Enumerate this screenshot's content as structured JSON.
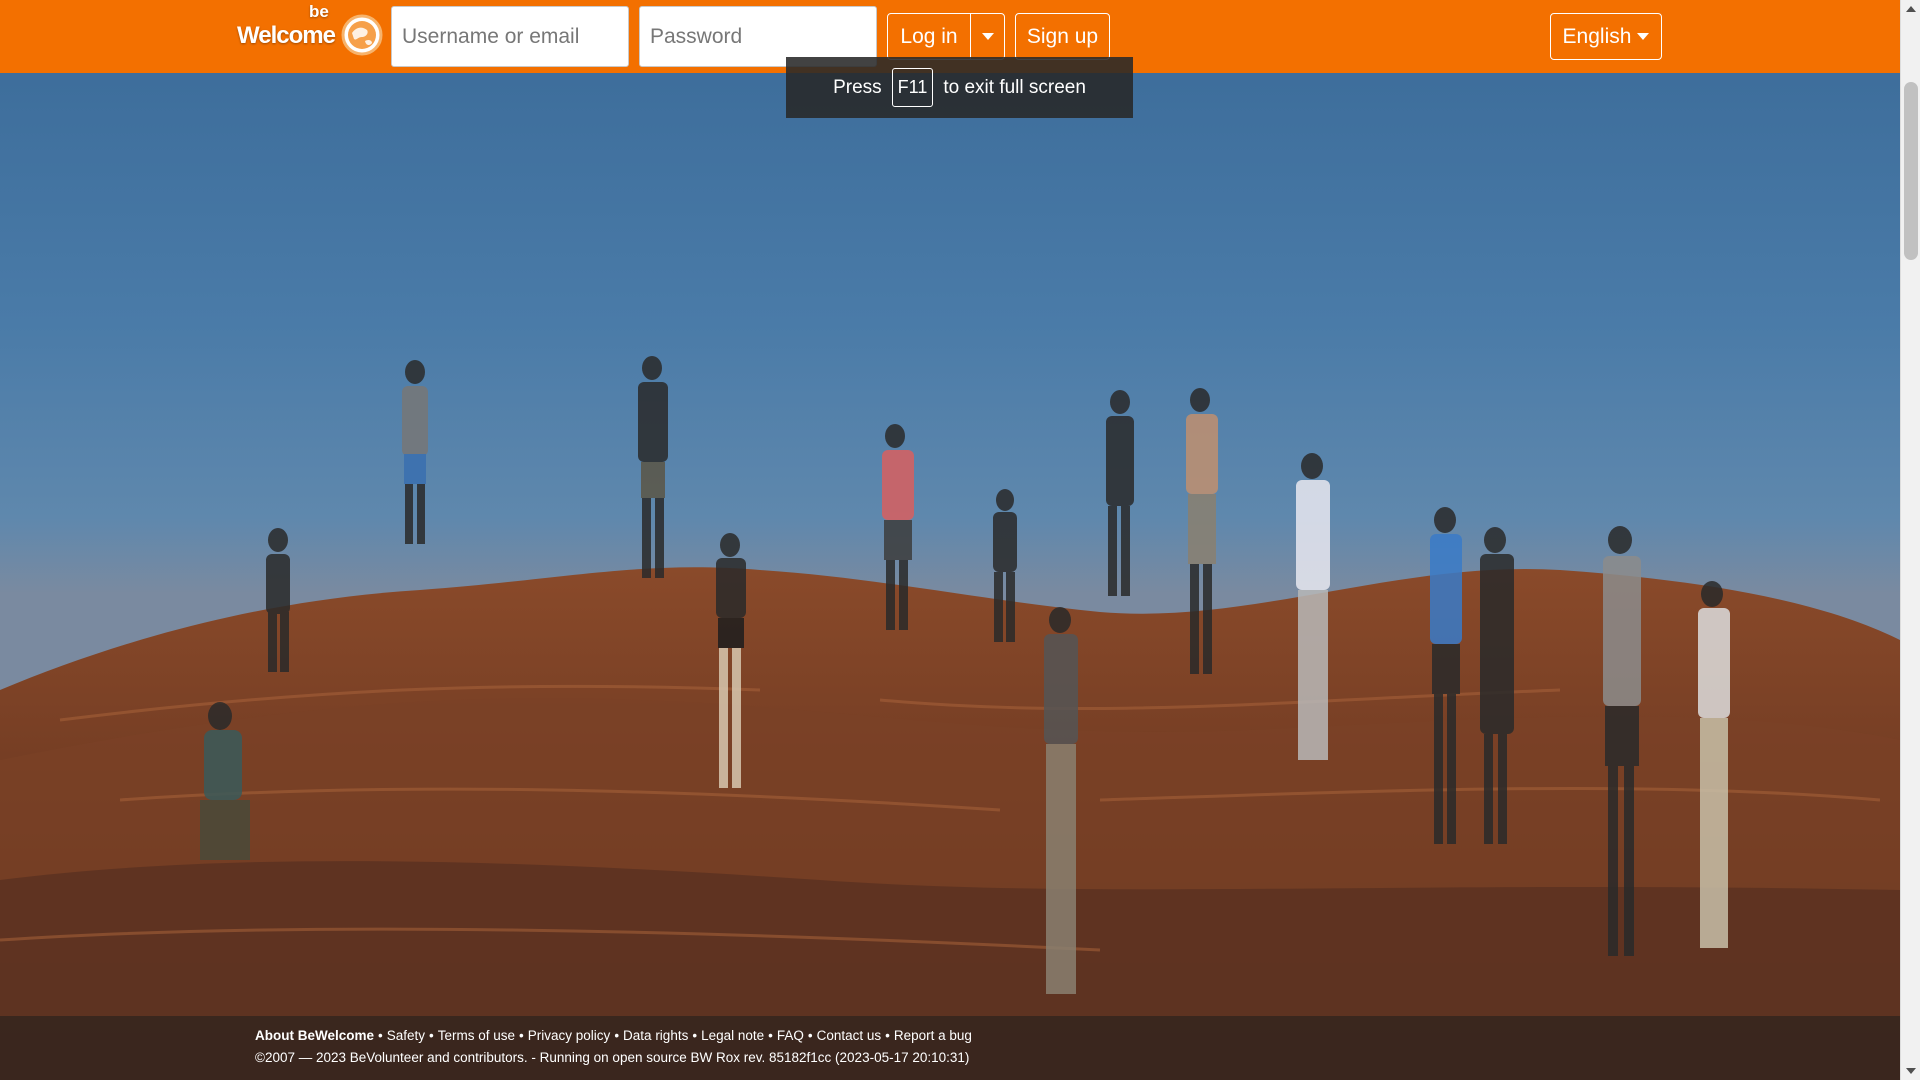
{
  "brand": {
    "logo_word": "Welcome",
    "logo_prefix": "be",
    "accent_color": "#f37000"
  },
  "login": {
    "username_placeholder": "Username or email",
    "password_placeholder": "Password",
    "login_label": "Log in",
    "signup_label": "Sign up"
  },
  "language": {
    "selected": "English"
  },
  "fullscreen_notice": {
    "press": "Press",
    "key": "F11",
    "suffix": "to exit full screen"
  },
  "footer": {
    "links": [
      "About BeWelcome",
      "Safety",
      "Terms of use",
      "Privacy policy",
      "Data rights",
      "Legal note",
      "FAQ",
      "Contact us",
      "Report a bug"
    ],
    "copyright": "©2007 — 2023 BeVolunteer and contributors. - Running on open source BW Rox rev. 85182f1cc (2023-05-17 20:10:31)"
  },
  "icons": [
    "globe-icon",
    "caret-down-icon"
  ]
}
